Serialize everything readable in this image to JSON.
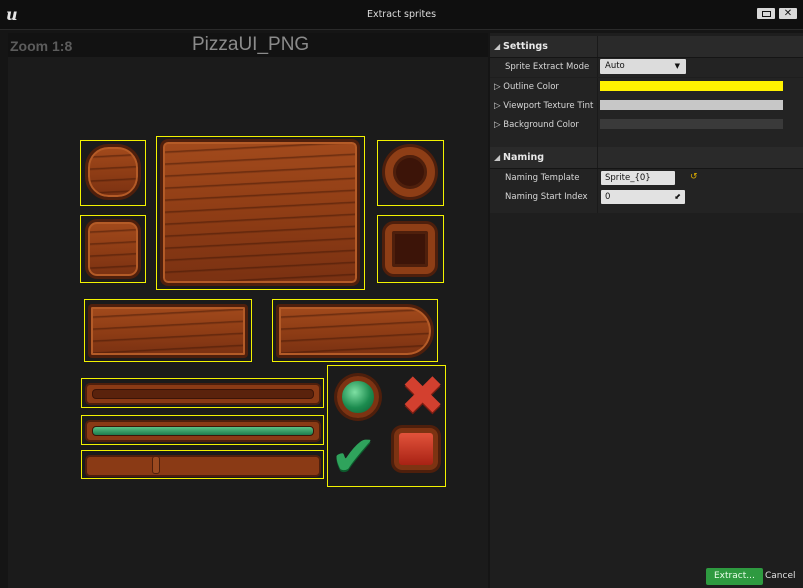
{
  "window": {
    "title": "Extract sprites",
    "logo_glyph": "u"
  },
  "viewport": {
    "zoom": "Zoom 1:8",
    "asset_name": "PizzaUI_PNG"
  },
  "settings": {
    "header": "Settings",
    "rows": {
      "extract_mode_label": "Sprite Extract Mode",
      "extract_mode_value": "Auto",
      "outline_color_label": "Outline Color",
      "viewport_tint_label": "Viewport Texture Tint",
      "background_color_label": "Background Color"
    },
    "colors": {
      "outline": "#fff200",
      "viewport_tint": "#c7c7c7",
      "background": "#3a3a3a"
    }
  },
  "naming": {
    "header": "Naming",
    "template_label": "Naming Template",
    "template_value": "Sprite_{0}",
    "start_index_label": "Naming Start Index",
    "start_index_value": "0"
  },
  "footer": {
    "extract_label": "Extract...",
    "cancel_label": "Cancel"
  },
  "glyphs": {
    "collapse": "◢",
    "expand": "▷",
    "dropdown": "▼",
    "reset": "↺",
    "spin": "⬋",
    "close": "✕",
    "cross": "✖",
    "check": "✔"
  }
}
